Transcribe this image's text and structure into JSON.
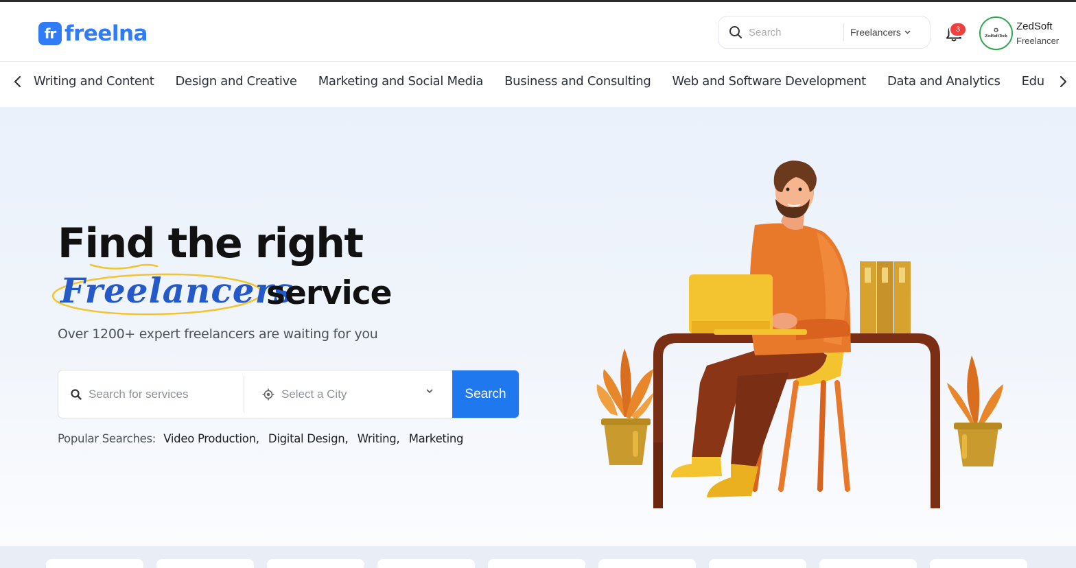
{
  "brand": {
    "logo_mark": "fr",
    "name": "freelna",
    "color": "#2f7cf6"
  },
  "header": {
    "search_placeholder": "Search",
    "search_type": "Freelancers",
    "notifications_count": "3",
    "user": {
      "avatar_text": "ZedSoftTech",
      "name": "ZedSoft",
      "role": "Freelancer"
    }
  },
  "categories": [
    "Writing and Content",
    "Design and Creative",
    "Marketing and Social Media",
    "Business and Consulting",
    "Web and Software Development",
    "Data and Analytics",
    "Edu"
  ],
  "hero": {
    "title_line1": "Find the right",
    "title_highlight": "Freelancers",
    "title_line2_rest": "service",
    "subtitle": "Over 1200+ expert freelancers are waiting for you",
    "search_placeholder": "Search for services",
    "city_placeholder": "Select a City",
    "search_button": "Search",
    "popular_label": "Popular Searches:",
    "popular_tags": [
      "Video Production,",
      "Digital Design,",
      "Writing,",
      "Marketing"
    ]
  },
  "colors": {
    "accent": "#1f78ee",
    "badge": "#ef3e3e",
    "highlight_text": "#2459c9",
    "avatar_ring": "#2fa84f"
  }
}
